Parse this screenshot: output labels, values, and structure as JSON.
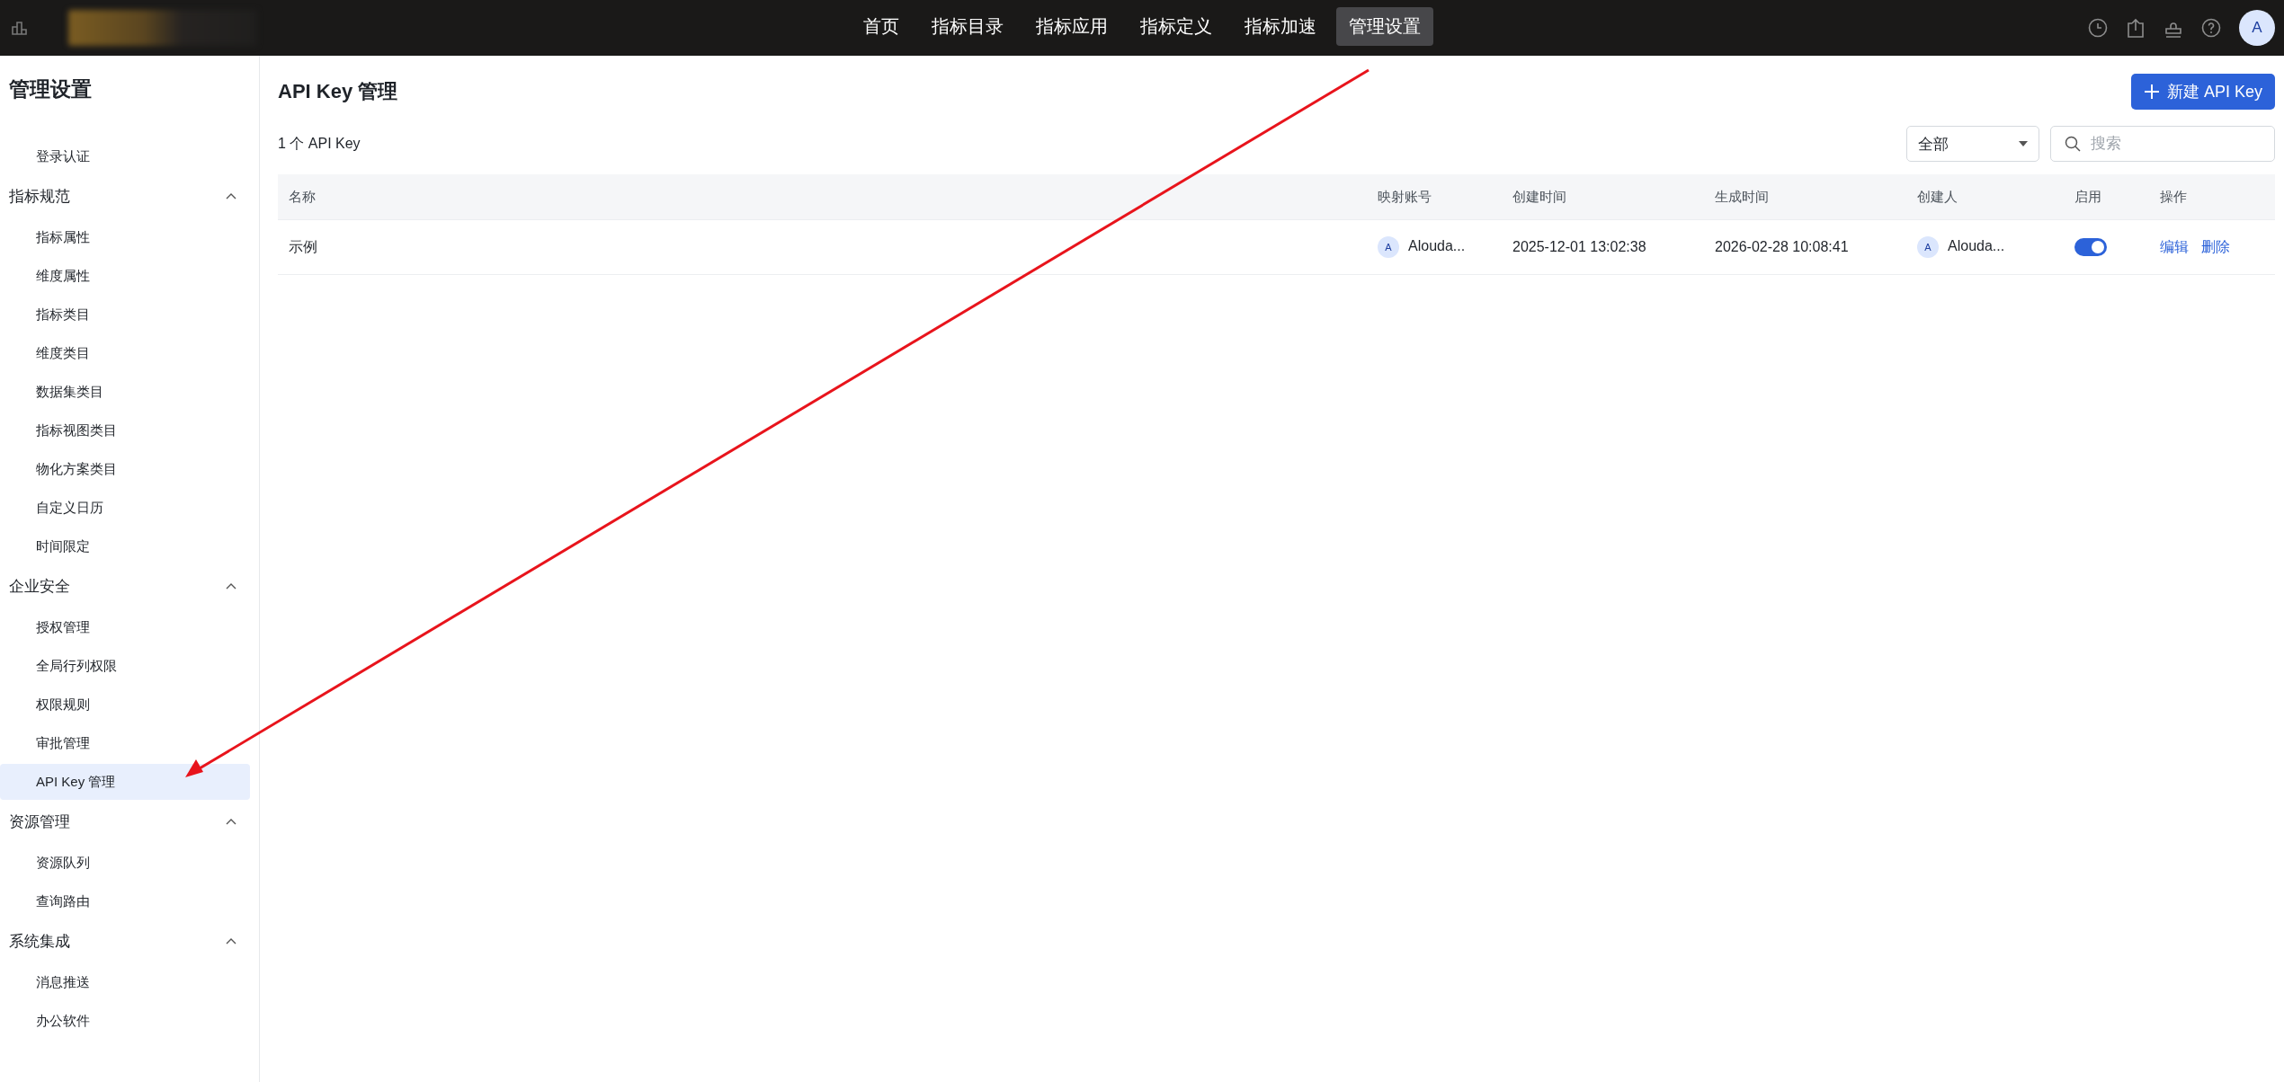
{
  "topbar": {
    "nav": [
      {
        "label": "首页",
        "selected": false
      },
      {
        "label": "指标目录",
        "selected": false
      },
      {
        "label": "指标应用",
        "selected": false
      },
      {
        "label": "指标定义",
        "selected": false
      },
      {
        "label": "指标加速",
        "selected": false
      },
      {
        "label": "管理设置",
        "selected": true
      }
    ],
    "avatar": "A"
  },
  "sidebar": {
    "title": "管理设置",
    "leading_items": [
      {
        "label": "登录认证",
        "selected": false
      }
    ],
    "groups": [
      {
        "label": "指标规范",
        "expanded": true,
        "children": [
          {
            "label": "指标属性",
            "selected": false
          },
          {
            "label": "维度属性",
            "selected": false
          },
          {
            "label": "指标类目",
            "selected": false
          },
          {
            "label": "维度类目",
            "selected": false
          },
          {
            "label": "数据集类目",
            "selected": false
          },
          {
            "label": "指标视图类目",
            "selected": false
          },
          {
            "label": "物化方案类目",
            "selected": false
          },
          {
            "label": "自定义日历",
            "selected": false
          },
          {
            "label": "时间限定",
            "selected": false
          }
        ]
      },
      {
        "label": "企业安全",
        "expanded": true,
        "children": [
          {
            "label": "授权管理",
            "selected": false
          },
          {
            "label": "全局行列权限",
            "selected": false
          },
          {
            "label": "权限规则",
            "selected": false
          },
          {
            "label": "审批管理",
            "selected": false
          },
          {
            "label": "API Key 管理",
            "selected": true
          }
        ]
      },
      {
        "label": "资源管理",
        "expanded": true,
        "children": [
          {
            "label": "资源队列",
            "selected": false
          },
          {
            "label": "查询路由",
            "selected": false
          }
        ]
      },
      {
        "label": "系统集成",
        "expanded": true,
        "children": [
          {
            "label": "消息推送",
            "selected": false
          },
          {
            "label": "办公软件",
            "selected": false
          }
        ]
      }
    ]
  },
  "main": {
    "title": "API Key 管理",
    "new_button": "新建 API Key",
    "count": "1 个 API Key",
    "filter": {
      "value": "全部"
    },
    "search": {
      "placeholder": "搜索"
    },
    "table": {
      "columns": [
        "名称",
        "映射账号",
        "创建时间",
        "生成时间",
        "创建人",
        "启用",
        "操作"
      ],
      "rows": [
        {
          "name": "示例",
          "account_avatar": "A",
          "account": "Alouda...",
          "created": "2025-12-01 13:02:38",
          "generated": "2026-02-28 10:08:41",
          "creator_avatar": "A",
          "creator": "Alouda...",
          "enabled": true,
          "actions": [
            "编辑",
            "删除"
          ]
        }
      ]
    }
  },
  "annotation": {
    "kind": "arrow",
    "color": "#e8141c"
  }
}
